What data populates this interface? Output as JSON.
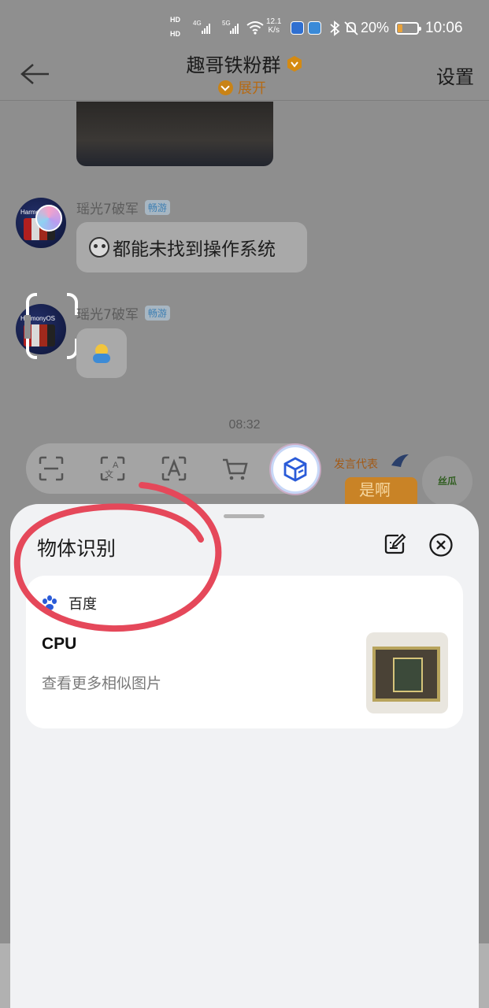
{
  "status_bar": {
    "hd1": "HD",
    "hd2": "HD",
    "net1": "4G",
    "net2": "5G",
    "speed_value": "12.1",
    "speed_unit": "K/s",
    "battery_percent": "20%",
    "time": "10:06"
  },
  "header": {
    "title": "趣哥铁粉群",
    "expand_label": "展开",
    "settings_label": "设置"
  },
  "chat": {
    "messages": [
      {
        "sender": "瑶光7破军",
        "tag": "畅游",
        "text": "都能未找到操作系统"
      },
      {
        "sender": "瑶光7破军",
        "tag": "畅游",
        "text": ""
      }
    ],
    "avatar_label": "HarmonyOS",
    "timestamp": "08:32",
    "decoration_text": "发言代表",
    "decoration_sign": "是啊",
    "decoration_circle": "丝瓜"
  },
  "toolbar": {
    "tools": [
      "scan-icon",
      "translate-icon",
      "text-recognition-icon",
      "shopping-cart-icon",
      "object-recognition-icon"
    ],
    "active_tool": "object-recognition-icon"
  },
  "sheet": {
    "title": "物体识别",
    "provider": "百度",
    "result_name": "CPU",
    "result_link": "查看更多相似图片"
  },
  "colors": {
    "accent_blue": "#2a5bd8",
    "annotation_red": "#e5485a",
    "expand_orange": "#c98316"
  }
}
